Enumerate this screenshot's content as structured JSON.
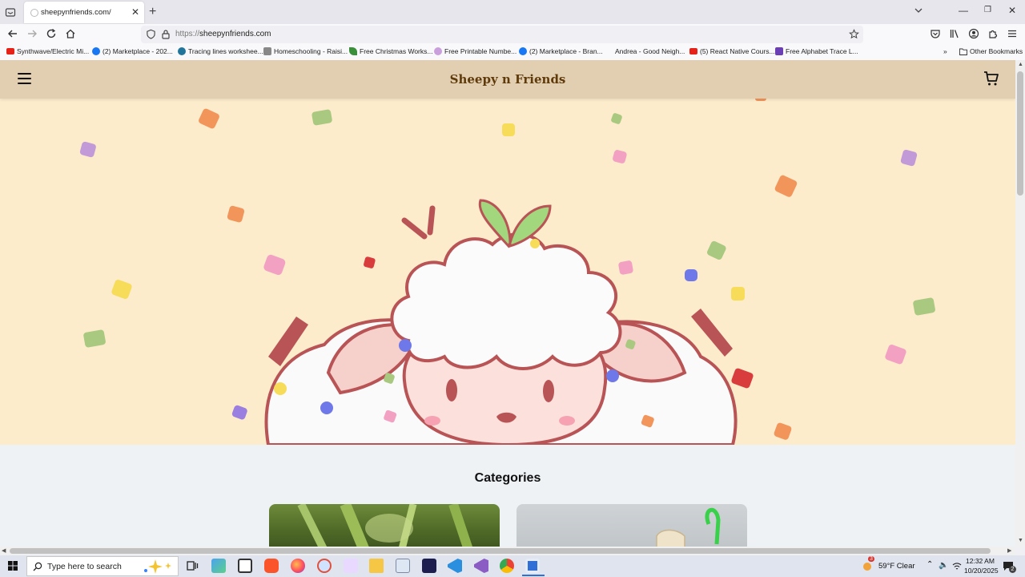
{
  "browser": {
    "tab": {
      "title": "sheepynfriends.com/"
    },
    "url": {
      "protocol": "https://",
      "host": "sheepynfriends.com"
    },
    "bookmarks": [
      {
        "label": "Synthwave/Electric Mi...",
        "icon": "youtube-icon",
        "color": "#e62117"
      },
      {
        "label": "(2) Marketplace - 202...",
        "icon": "facebook-icon",
        "color": "#1877f2"
      },
      {
        "label": "Tracing lines workshee...",
        "icon": "wordpress-icon",
        "color": "#21759b"
      },
      {
        "label": "Homeschooling - Raisi...",
        "icon": "site-icon",
        "color": "#666666"
      },
      {
        "label": "Free Christmas Works...",
        "icon": "leaf-icon",
        "color": "#3a8f3a"
      },
      {
        "label": "Free Printable Numbe...",
        "icon": "circle-icon",
        "color": "#c9a0dc"
      },
      {
        "label": "(2) Marketplace - Bran...",
        "icon": "facebook-icon",
        "color": "#1877f2"
      },
      {
        "label": "Andrea - Good Neigh...",
        "icon": "blank-icon",
        "color": "#f9f9fb"
      },
      {
        "label": "(5) React Native Cours...",
        "icon": "youtube-icon",
        "color": "#e62117"
      },
      {
        "label": "Free Alphabet Trace L...",
        "icon": "site-icon",
        "color": "#6a3fb5"
      }
    ],
    "other_bookmarks": "Other Bookmarks"
  },
  "site": {
    "title": "Sheepy n Friends",
    "categories_heading": "Categories",
    "header_color": "#e2ceb1",
    "hero_color": "#fdeccc"
  },
  "taskbar": {
    "search_placeholder": "Type here to search",
    "weather": "59°F  Clear",
    "weather_badge": "3",
    "time": "12:32 AM",
    "date": "10/20/2025",
    "notification_count": "2"
  }
}
